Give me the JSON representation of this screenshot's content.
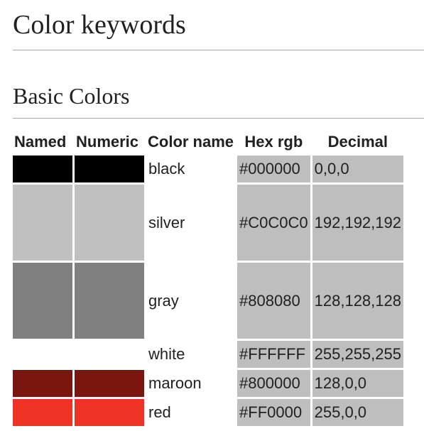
{
  "page": {
    "title": "Color keywords",
    "section_title": "Basic Colors"
  },
  "table": {
    "headers": {
      "named": "Named",
      "numeric": "Numeric",
      "color_name": "Color name",
      "hex": "Hex rgb",
      "decimal": "Decimal"
    },
    "rows": [
      {
        "name": "black",
        "hex": "#000000",
        "decimal": "0,0,0",
        "swatch": "#000000",
        "height": 38
      },
      {
        "name": "silver",
        "hex": "#C0C0C0",
        "decimal": "192,192,192",
        "swatch": "#c0c0c0",
        "height": 107
      },
      {
        "name": "gray",
        "hex": "#808080",
        "decimal": "128,128,128",
        "swatch": "#808080",
        "height": 107
      },
      {
        "name": "white",
        "hex": "#FFFFFF",
        "decimal": "255,255,255",
        "swatch": "#ffffff",
        "height": 38
      },
      {
        "name": "maroon",
        "hex": "#800000",
        "decimal": "128,0,0",
        "swatch": "#7a1510",
        "height": 38
      },
      {
        "name": "red",
        "hex": "#FF0000",
        "decimal": "255,0,0",
        "swatch": "#ee3325",
        "height": 38
      }
    ]
  }
}
